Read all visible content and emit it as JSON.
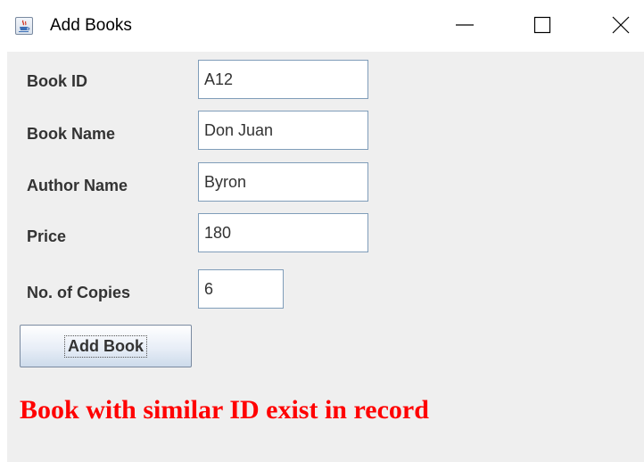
{
  "window": {
    "title": "Add Books",
    "icon": "java-cup-icon",
    "controls": [
      "minimize-icon",
      "maximize-icon",
      "close-icon"
    ]
  },
  "form": {
    "fields": [
      {
        "label": "Book ID",
        "value": "A12"
      },
      {
        "label": "Book Name",
        "value": "Don Juan"
      },
      {
        "label": "Author Name",
        "value": "Byron"
      },
      {
        "label": "Price",
        "value": "180"
      },
      {
        "label": "No. of Copies",
        "value": "6"
      }
    ],
    "submit_label": "Add Book"
  },
  "status": {
    "message": "Book with similar ID exist in record",
    "color": "#ff0000"
  }
}
